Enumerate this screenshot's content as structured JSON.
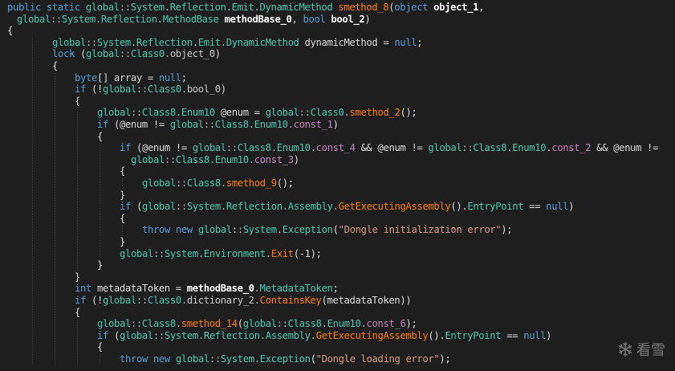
{
  "code_lines": [
    {
      "indent": 0,
      "tokens": [
        [
          "kw",
          "public static "
        ],
        [
          "ns",
          "global"
        ],
        [
          "op",
          "::"
        ],
        [
          "ns",
          "System"
        ],
        [
          "op",
          "."
        ],
        [
          "ns",
          "Reflection"
        ],
        [
          "op",
          "."
        ],
        [
          "ns",
          "Emit"
        ],
        [
          "op",
          "."
        ],
        [
          "ty",
          "DynamicMethod "
        ],
        [
          "mth",
          "smethod_8"
        ],
        [
          "id",
          "("
        ],
        [
          "kw",
          "object "
        ],
        [
          "bold",
          "object_1"
        ],
        [
          "id",
          ","
        ]
      ]
    },
    {
      "indent": 1,
      "tokens": [
        [
          "ns",
          "global"
        ],
        [
          "op",
          "::"
        ],
        [
          "ns",
          "System"
        ],
        [
          "op",
          "."
        ],
        [
          "ns",
          "Reflection"
        ],
        [
          "op",
          "."
        ],
        [
          "ty",
          "MethodBase "
        ],
        [
          "bold",
          "methodBase_0"
        ],
        [
          "id",
          ", "
        ],
        [
          "kw",
          "bool "
        ],
        [
          "bold",
          "bool_2"
        ],
        [
          "id",
          ")"
        ]
      ]
    },
    {
      "indent": 0,
      "tokens": [
        [
          "id",
          "{"
        ]
      ]
    },
    {
      "indent": 2,
      "tokens": [
        [
          "ns",
          "global"
        ],
        [
          "op",
          "::"
        ],
        [
          "ns",
          "System"
        ],
        [
          "op",
          "."
        ],
        [
          "ns",
          "Reflection"
        ],
        [
          "op",
          "."
        ],
        [
          "ns",
          "Emit"
        ],
        [
          "op",
          "."
        ],
        [
          "ty",
          "DynamicMethod "
        ],
        [
          "id",
          "dynamicMethod = "
        ],
        [
          "kw",
          "null"
        ],
        [
          "id",
          ";"
        ]
      ]
    },
    {
      "indent": 2,
      "tokens": [
        [
          "kw",
          "lock "
        ],
        [
          "id",
          "("
        ],
        [
          "ns",
          "global"
        ],
        [
          "op",
          "::"
        ],
        [
          "cls",
          "Class0"
        ],
        [
          "op",
          "."
        ],
        [
          "fld",
          "object_0"
        ],
        [
          "id",
          ")"
        ]
      ]
    },
    {
      "indent": 2,
      "tokens": [
        [
          "id",
          "{"
        ]
      ]
    },
    {
      "indent": 3,
      "tokens": [
        [
          "kw",
          "byte"
        ],
        [
          "id",
          "[] array = "
        ],
        [
          "kw",
          "null"
        ],
        [
          "id",
          ";"
        ]
      ]
    },
    {
      "indent": 3,
      "tokens": [
        [
          "kw",
          "if "
        ],
        [
          "id",
          "(!"
        ],
        [
          "ns",
          "global"
        ],
        [
          "op",
          "::"
        ],
        [
          "cls",
          "Class0"
        ],
        [
          "op",
          "."
        ],
        [
          "fld",
          "bool_0"
        ],
        [
          "id",
          ")"
        ]
      ]
    },
    {
      "indent": 3,
      "tokens": [
        [
          "id",
          "{"
        ]
      ]
    },
    {
      "indent": 4,
      "tokens": [
        [
          "ns",
          "global"
        ],
        [
          "op",
          "::"
        ],
        [
          "cls",
          "Class8"
        ],
        [
          "op",
          "."
        ],
        [
          "ty",
          "Enum10 "
        ],
        [
          "id",
          "@enum = "
        ],
        [
          "ns",
          "global"
        ],
        [
          "op",
          "::"
        ],
        [
          "cls",
          "Class0"
        ],
        [
          "op",
          "."
        ],
        [
          "mth",
          "smethod_2"
        ],
        [
          "id",
          "();"
        ]
      ]
    },
    {
      "indent": 4,
      "tokens": [
        [
          "kw",
          "if "
        ],
        [
          "id",
          "(@enum != "
        ],
        [
          "ns",
          "global"
        ],
        [
          "op",
          "::"
        ],
        [
          "cls",
          "Class8"
        ],
        [
          "op",
          "."
        ],
        [
          "ty",
          "Enum10"
        ],
        [
          "op",
          "."
        ],
        [
          "cst",
          "const_1"
        ],
        [
          "id",
          ")"
        ]
      ]
    },
    {
      "indent": 4,
      "tokens": [
        [
          "id",
          "{"
        ]
      ]
    },
    {
      "indent": 5,
      "tokens": [
        [
          "kw",
          "if "
        ],
        [
          "id",
          "(@enum != "
        ],
        [
          "ns",
          "global"
        ],
        [
          "op",
          "::"
        ],
        [
          "cls",
          "Class8"
        ],
        [
          "op",
          "."
        ],
        [
          "ty",
          "Enum10"
        ],
        [
          "op",
          "."
        ],
        [
          "cst",
          "const_4"
        ],
        [
          "id",
          " && @enum != "
        ],
        [
          "ns",
          "global"
        ],
        [
          "op",
          "::"
        ],
        [
          "cls",
          "Class8"
        ],
        [
          "op",
          "."
        ],
        [
          "ty",
          "Enum10"
        ],
        [
          "op",
          "."
        ],
        [
          "cst",
          "const_2"
        ],
        [
          "id",
          " && @enum !="
        ]
      ]
    },
    {
      "indent": 5.5,
      "tokens": [
        [
          "ns",
          "global"
        ],
        [
          "op",
          "::"
        ],
        [
          "cls",
          "Class8"
        ],
        [
          "op",
          "."
        ],
        [
          "ty",
          "Enum10"
        ],
        [
          "op",
          "."
        ],
        [
          "cst",
          "const_3"
        ],
        [
          "id",
          ")"
        ]
      ]
    },
    {
      "indent": 5,
      "tokens": [
        [
          "id",
          "{"
        ]
      ]
    },
    {
      "indent": 6,
      "tokens": [
        [
          "ns",
          "global"
        ],
        [
          "op",
          "::"
        ],
        [
          "cls",
          "Class8"
        ],
        [
          "op",
          "."
        ],
        [
          "mth",
          "smethod_9"
        ],
        [
          "id",
          "();"
        ]
      ]
    },
    {
      "indent": 5,
      "tokens": [
        [
          "id",
          "}"
        ]
      ]
    },
    {
      "indent": 5,
      "tokens": [
        [
          "kw",
          "if "
        ],
        [
          "id",
          "("
        ],
        [
          "ns",
          "global"
        ],
        [
          "op",
          "::"
        ],
        [
          "ns",
          "System"
        ],
        [
          "op",
          "."
        ],
        [
          "ns",
          "Reflection"
        ],
        [
          "op",
          "."
        ],
        [
          "ty",
          "Assembly"
        ],
        [
          "op",
          "."
        ],
        [
          "mth",
          "GetExecutingAssembly"
        ],
        [
          "id",
          "()."
        ],
        [
          "prop",
          "EntryPoint"
        ],
        [
          "id",
          " == "
        ],
        [
          "kw",
          "null"
        ],
        [
          "id",
          ")"
        ]
      ]
    },
    {
      "indent": 5,
      "tokens": [
        [
          "id",
          "{"
        ]
      ]
    },
    {
      "indent": 6,
      "tokens": [
        [
          "kw",
          "throw new "
        ],
        [
          "ns",
          "global"
        ],
        [
          "op",
          "::"
        ],
        [
          "ns",
          "System"
        ],
        [
          "op",
          "."
        ],
        [
          "ty",
          "Exception"
        ],
        [
          "id",
          "("
        ],
        [
          "str",
          "\"Dongle initialization error\""
        ],
        [
          "id",
          ");"
        ]
      ]
    },
    {
      "indent": 5,
      "tokens": [
        [
          "id",
          "}"
        ]
      ]
    },
    {
      "indent": 5,
      "tokens": [
        [
          "ns",
          "global"
        ],
        [
          "op",
          "::"
        ],
        [
          "ns",
          "System"
        ],
        [
          "op",
          "."
        ],
        [
          "ty",
          "Environment"
        ],
        [
          "op",
          "."
        ],
        [
          "mth",
          "Exit"
        ],
        [
          "id",
          "(-1);"
        ]
      ]
    },
    {
      "indent": 4,
      "tokens": [
        [
          "id",
          "}"
        ]
      ]
    },
    {
      "indent": 3,
      "tokens": [
        [
          "id",
          "}"
        ]
      ]
    },
    {
      "indent": 3,
      "tokens": [
        [
          "kw",
          "int "
        ],
        [
          "id",
          "metadataToken = "
        ],
        [
          "bold",
          "methodBase_0"
        ],
        [
          "op",
          "."
        ],
        [
          "prop",
          "MetadataToken"
        ],
        [
          "id",
          ";"
        ]
      ]
    },
    {
      "indent": 3,
      "tokens": [
        [
          "kw",
          "if "
        ],
        [
          "id",
          "(!"
        ],
        [
          "ns",
          "global"
        ],
        [
          "op",
          "::"
        ],
        [
          "cls",
          "Class0"
        ],
        [
          "op",
          "."
        ],
        [
          "fld",
          "dictionary_2"
        ],
        [
          "op",
          "."
        ],
        [
          "mth",
          "ContainsKey"
        ],
        [
          "id",
          "(metadataToken))"
        ]
      ]
    },
    {
      "indent": 3,
      "tokens": [
        [
          "id",
          "{"
        ]
      ]
    },
    {
      "indent": 4,
      "tokens": [
        [
          "ns",
          "global"
        ],
        [
          "op",
          "::"
        ],
        [
          "cls",
          "Class8"
        ],
        [
          "op",
          "."
        ],
        [
          "mth",
          "smethod_14"
        ],
        [
          "id",
          "("
        ],
        [
          "ns",
          "global"
        ],
        [
          "op",
          "::"
        ],
        [
          "cls",
          "Class8"
        ],
        [
          "op",
          "."
        ],
        [
          "ty",
          "Enum10"
        ],
        [
          "op",
          "."
        ],
        [
          "cst",
          "const_6"
        ],
        [
          "id",
          ");"
        ]
      ]
    },
    {
      "indent": 4,
      "tokens": [
        [
          "kw",
          "if "
        ],
        [
          "id",
          "("
        ],
        [
          "ns",
          "global"
        ],
        [
          "op",
          "::"
        ],
        [
          "ns",
          "System"
        ],
        [
          "op",
          "."
        ],
        [
          "ns",
          "Reflection"
        ],
        [
          "op",
          "."
        ],
        [
          "ty",
          "Assembly"
        ],
        [
          "op",
          "."
        ],
        [
          "mth",
          "GetExecutingAssembly"
        ],
        [
          "id",
          "()."
        ],
        [
          "prop",
          "EntryPoint"
        ],
        [
          "id",
          " == "
        ],
        [
          "kw",
          "null"
        ],
        [
          "id",
          ")"
        ]
      ]
    },
    {
      "indent": 4,
      "tokens": [
        [
          "id",
          "{"
        ]
      ]
    },
    {
      "indent": 5,
      "tokens": [
        [
          "kw",
          "throw new "
        ],
        [
          "ns",
          "global"
        ],
        [
          "op",
          "::"
        ],
        [
          "ns",
          "System"
        ],
        [
          "op",
          "."
        ],
        [
          "ty",
          "Exception"
        ],
        [
          "id",
          "("
        ],
        [
          "str",
          "\"Dongle loading error\""
        ],
        [
          "id",
          ");"
        ]
      ]
    }
  ],
  "watermark": {
    "icon": "snowflake-icon",
    "text": "看雪"
  },
  "colors": {
    "background": "#1e1e1e",
    "keyword": "#569cd6",
    "type": "#4ec9b0",
    "method": "#ff8000",
    "string": "#d69d85",
    "constant": "#c586c0"
  }
}
